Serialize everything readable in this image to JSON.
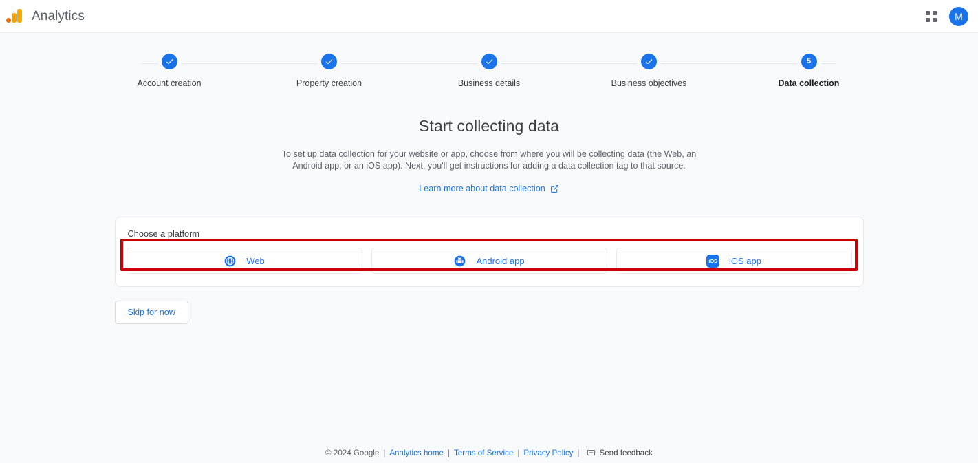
{
  "appbar": {
    "brand": "Analytics",
    "logo_icon": "analytics-logo-icon",
    "apps_icon": "apps-grid-icon",
    "avatar_initial": "M",
    "avatar_color": "#1a73e8"
  },
  "stepper": {
    "steps": [
      {
        "label": "Account creation",
        "state": "complete",
        "marker": "check-icon"
      },
      {
        "label": "Property creation",
        "state": "complete",
        "marker": "check-icon"
      },
      {
        "label": "Business details",
        "state": "complete",
        "marker": "check-icon"
      },
      {
        "label": "Business objectives",
        "state": "complete",
        "marker": "check-icon"
      },
      {
        "label": "Data collection",
        "state": "current",
        "marker": "5"
      }
    ]
  },
  "hero": {
    "title": "Start collecting data",
    "description": "To set up data collection for your website or app, choose from where you will be collecting data (the Web, an Android app, or an iOS app). Next, you'll get instructions for adding a data collection tag to that source.",
    "learn_more_label": "Learn more about data collection",
    "learn_more_icon": "external-link-icon"
  },
  "platform_card": {
    "title": "Choose a platform",
    "options": [
      {
        "label": "Web",
        "icon": "globe-icon"
      },
      {
        "label": "Android app",
        "icon": "android-icon"
      },
      {
        "label": "iOS app",
        "icon": "ios-badge-icon",
        "badge_text": "iOS"
      }
    ],
    "highlight_color": "#cc0000"
  },
  "skip": {
    "label": "Skip for now"
  },
  "footer": {
    "copyright": "© 2024 Google",
    "sep": "|",
    "links": [
      {
        "label": "Analytics home"
      },
      {
        "label": "Terms of Service"
      },
      {
        "label": "Privacy Policy"
      }
    ],
    "feedback_label": "Send feedback",
    "feedback_icon": "feedback-icon"
  }
}
